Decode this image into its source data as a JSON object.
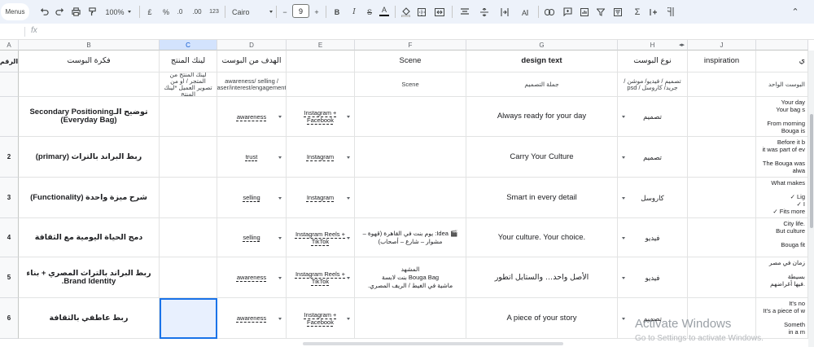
{
  "toolbar": {
    "menus": "Menus",
    "zoom": "100%",
    "currency": "£",
    "percent": "%",
    "dec_less": ".0",
    "dec_more": ".00",
    "format_123": "123",
    "font": "Cairo",
    "font_size": "9",
    "minus": "−",
    "plus": "+",
    "bold": "B",
    "italic": "I",
    "strike": "S",
    "text_color": "A",
    "collapse": "⌃"
  },
  "formula_bar": {
    "fx": "fx"
  },
  "columns": [
    {
      "key": "A",
      "label": "A"
    },
    {
      "key": "B",
      "label": "B"
    },
    {
      "key": "C",
      "label": "C"
    },
    {
      "key": "D",
      "label": "D"
    },
    {
      "key": "E",
      "label": "E"
    },
    {
      "key": "F",
      "label": "F"
    },
    {
      "key": "G",
      "label": "G"
    },
    {
      "key": "H",
      "label": "H"
    },
    {
      "key": "J",
      "label": "J"
    },
    {
      "key": "K",
      "label": ""
    }
  ],
  "header_row": {
    "num": "الرقم",
    "idea": "فكرة البوست",
    "link": "لينك المنتج",
    "goal": "الهدف من البوست",
    "platform": "",
    "scene": "Scene",
    "design": "design text",
    "type": "نوع البوست",
    "inspiration": "inspiration",
    "k": "ي"
  },
  "hint_row": {
    "link": "لينك المنتج من المتجر / او من تصوير العميل *لينك المنتج",
    "goal": "awareness/ selling / teaser/interest/engagement/..",
    "scene": "Scene",
    "design": "جملة التصميم",
    "type": "تصميم / فيديو/ موشن / جريد/ كاروسل / psd",
    "k": "البوست الواحد"
  },
  "rows": [
    {
      "num": "",
      "idea": "توضيح الـSecondary Positioning (Everyday Bag)",
      "goal": "awareness",
      "platform": "Instagram + Facebook",
      "scene": "",
      "design": "Always ready for your day",
      "type": "تصميم",
      "k": [
        "Your day",
        "Your bag s",
        "",
        "From morning",
        "Bouga is"
      ]
    },
    {
      "num": "2",
      "idea": "ربط البراند بالتراث (primary)",
      "goal": "trust",
      "platform": "Instagram",
      "scene": "",
      "design": "Carry Your Culture",
      "type": "تصميم",
      "k": [
        "Before it b",
        "it was part of ev",
        "",
        "The Bouga was",
        "alwa"
      ]
    },
    {
      "num": "3",
      "idea": "شرح ميزة واحدة (Functionality)",
      "goal": "selling",
      "platform": "Instagram",
      "scene": "",
      "design": "Smart in every detail",
      "type": "كاروسل",
      "k": [
        "What makes",
        "",
        "✓ Lig",
        "✓ I",
        "✓ Fits more"
      ]
    },
    {
      "num": "4",
      "idea": "دمج الحياة اليومية مع الثقافة",
      "goal": "selling",
      "platform": "Instagram Reels + TikTok",
      "scene": "🎬 Idea: يوم بنت في القاهرة (قهوة – مشوار – شارع – أصحاب)",
      "design": "Your culture. Your choice.",
      "type": "فيديو",
      "k": [
        "City life.",
        "But culture",
        "",
        "Bouga fit"
      ]
    },
    {
      "num": "5",
      "idea": "ربط البراند بالتراث المصري + بناء Brand Identity.",
      "goal": "awareness",
      "platform": "Instagram Reels + TikTok",
      "scene": "المشهد\nBouga Bag بنت لابسة\nماشية في الغيط / الريف المصري.",
      "design": "الأصل واحد… والستايل اتطور",
      "type": "فيديو",
      "k": [
        "زمان في مصر",
        "",
        "بسيطة",
        "فيها أغراضهم."
      ]
    },
    {
      "num": "6",
      "idea": "ربط عاطفي بالثقافة",
      "goal": "awareness",
      "platform": "Instagram + Facebook",
      "scene": "",
      "design": "A piece of your story",
      "type": "تصميم",
      "k": [
        "It's no",
        "It's a piece of w",
        "",
        "Someth",
        "in a m"
      ]
    }
  ],
  "watermark": {
    "title": "Activate Windows",
    "subtitle": "Go to Settings to activate Windows."
  }
}
